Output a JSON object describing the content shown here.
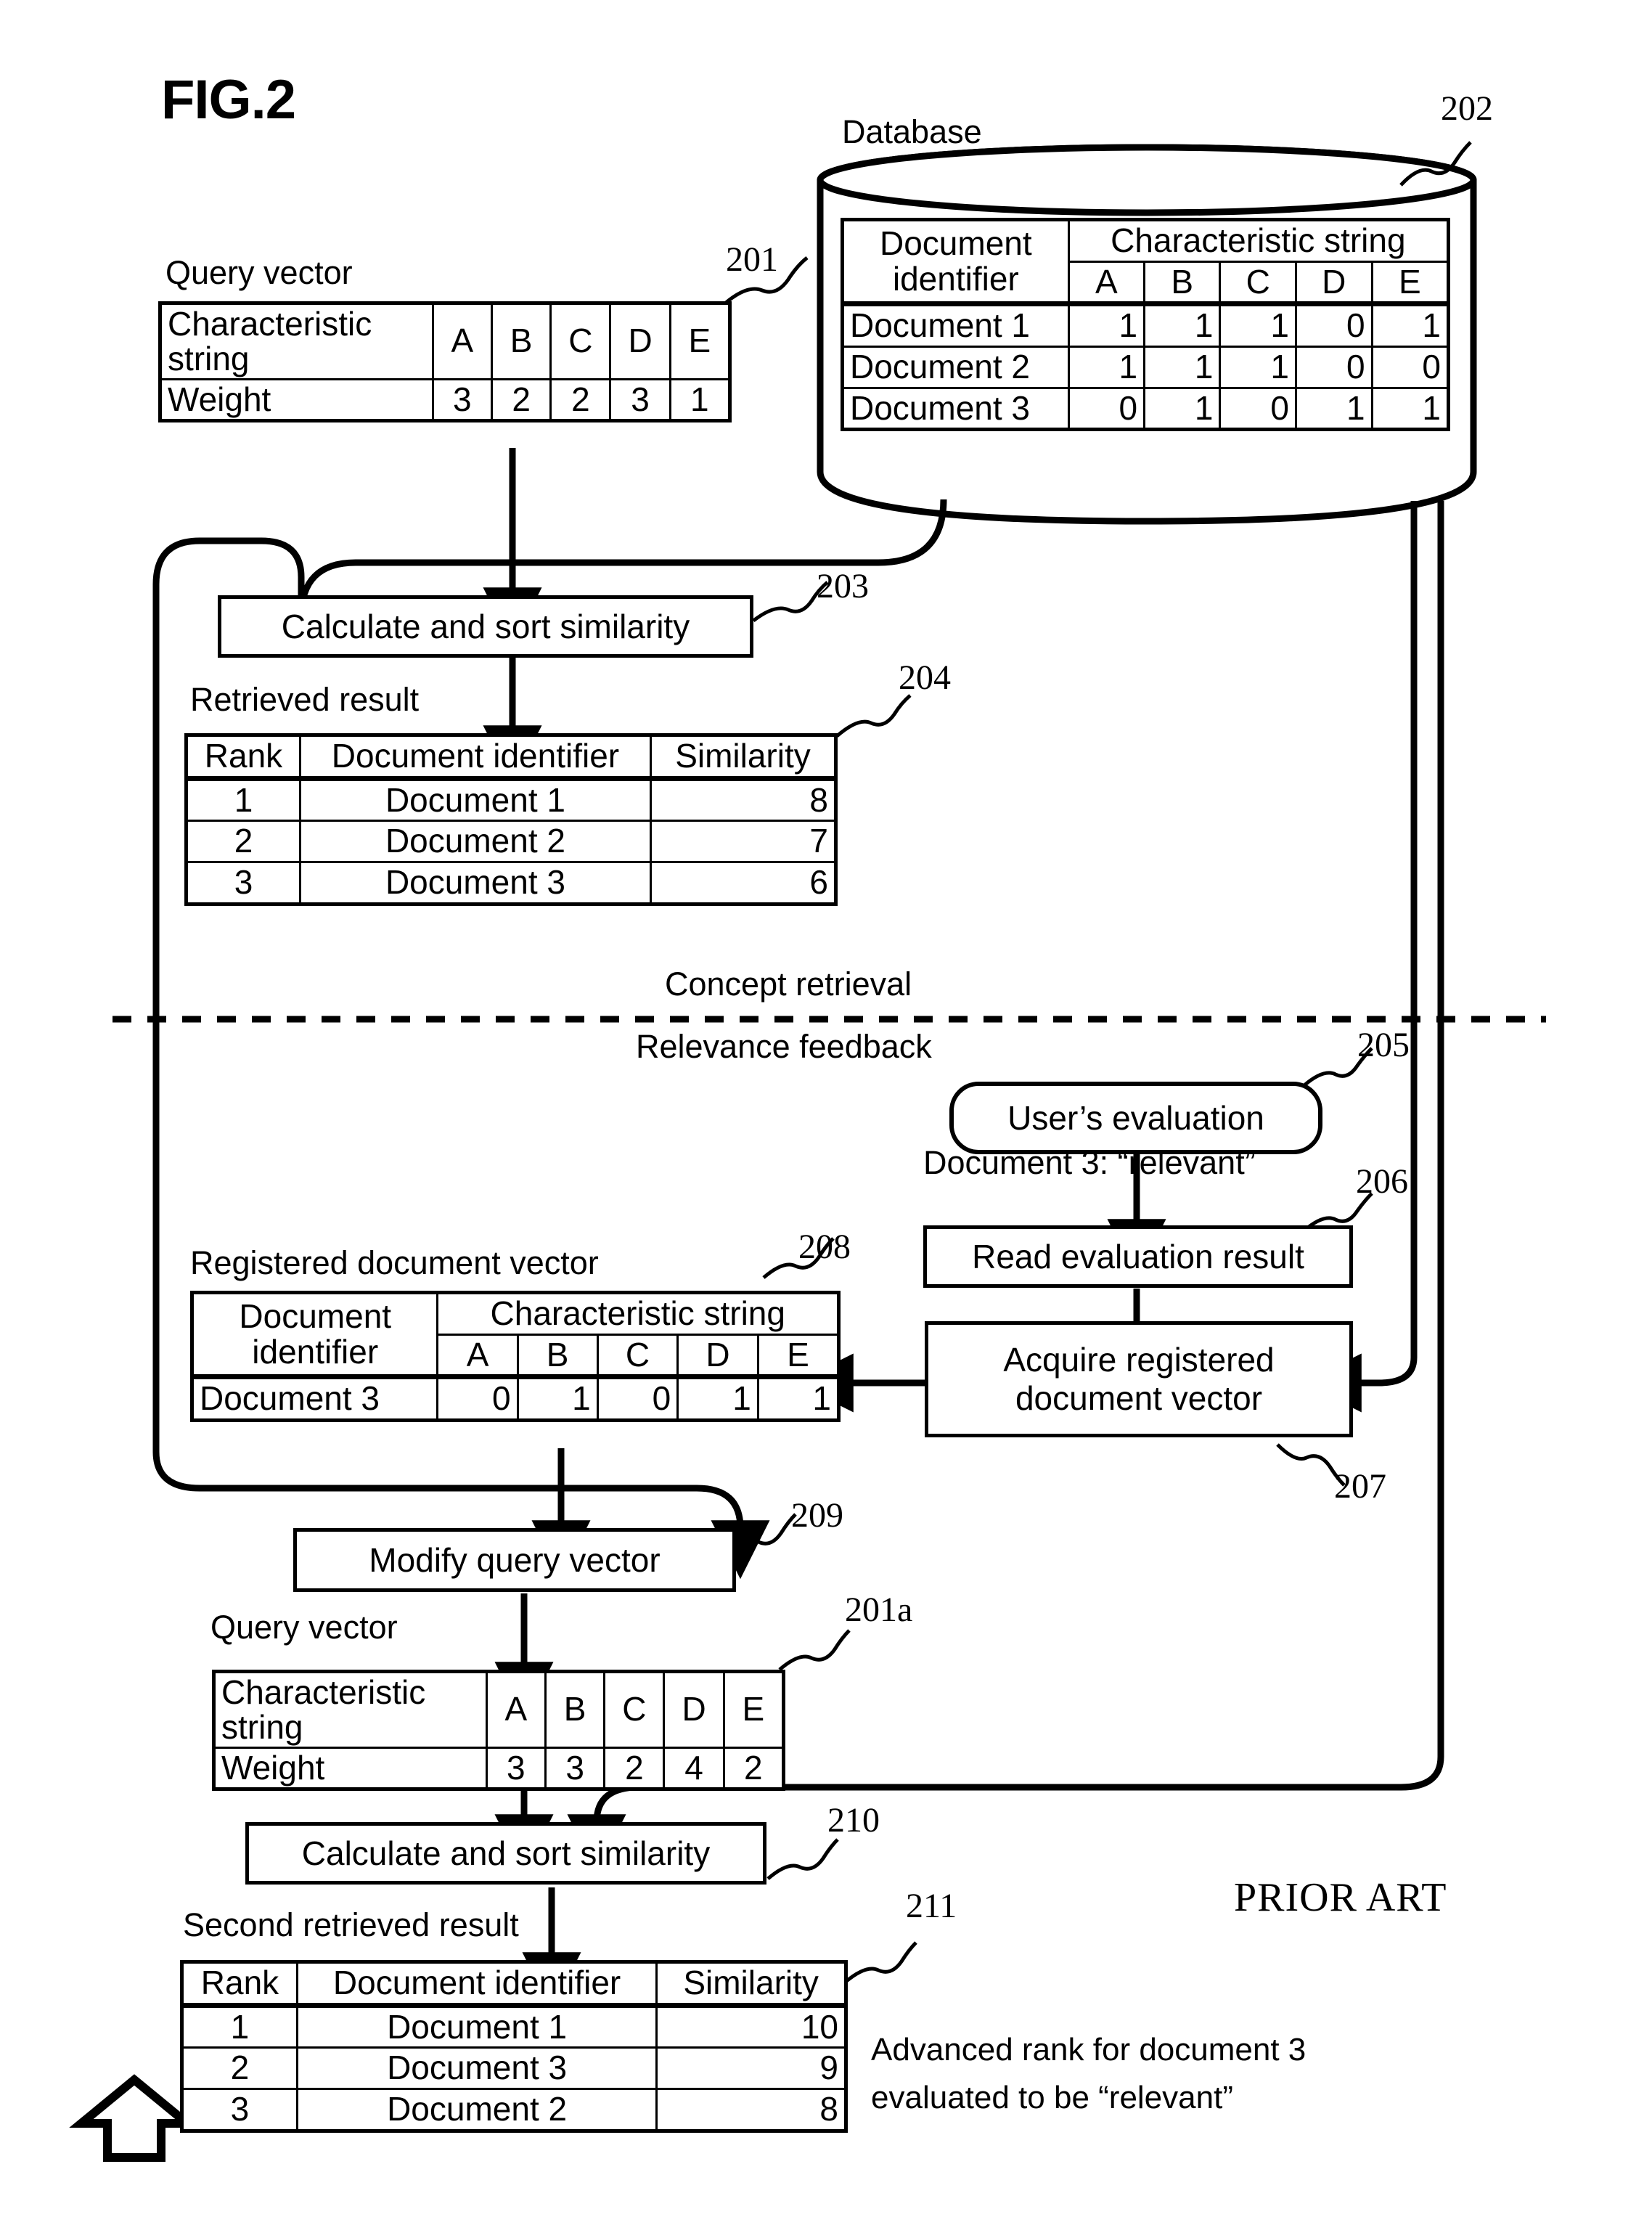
{
  "figure": {
    "title": "FIG.2",
    "prior_art": "PRIOR ART"
  },
  "labels": {
    "query_vector": "Query vector",
    "database": "Database",
    "retrieved_result": "Retrieved result",
    "concept_retrieval": "Concept retrieval",
    "relevance_feedback": "Relevance feedback",
    "registered_document_vector": "Registered document vector",
    "query_vector_2": "Query vector",
    "second_retrieved_result": "Second retrieved result",
    "evaluation_caption": "Document 3: “relevant”",
    "annotation_line1": "Advanced rank for document 3",
    "annotation_line2": "evaluated to be “relevant”"
  },
  "ref_numbers": {
    "n201": "201",
    "n202": "202",
    "n203": "203",
    "n204": "204",
    "n205": "205",
    "n206": "206",
    "n207": "207",
    "n208": "208",
    "n209": "209",
    "n210": "210",
    "n211": "211",
    "n201a": "201a"
  },
  "process_boxes": {
    "calc_sort_1": "Calculate and sort similarity",
    "users_evaluation": "User’s evaluation",
    "read_evaluation_result": "Read evaluation result",
    "acquire_registered_document_vector": "Acquire registered\ndocument vector",
    "modify_query_vector": "Modify query vector",
    "calc_sort_2": "Calculate and sort similarity"
  },
  "query_vector_201": {
    "row_header_1": "Characteristic string",
    "row_header_2": "Weight",
    "keys": [
      "A",
      "B",
      "C",
      "D",
      "E"
    ],
    "weights": [
      "3",
      "2",
      "2",
      "3",
      "1"
    ]
  },
  "query_vector_201a": {
    "row_header_1": "Characteristic string",
    "row_header_2": "Weight",
    "keys": [
      "A",
      "B",
      "C",
      "D",
      "E"
    ],
    "weights": [
      "3",
      "3",
      "2",
      "4",
      "2"
    ]
  },
  "database_202": {
    "col_header_id": "Document identifier",
    "col_header_group": "Characteristic string",
    "keys": [
      "A",
      "B",
      "C",
      "D",
      "E"
    ],
    "rows": [
      {
        "id": "Document 1",
        "values": [
          "1",
          "1",
          "1",
          "0",
          "1"
        ]
      },
      {
        "id": "Document 2",
        "values": [
          "1",
          "1",
          "1",
          "0",
          "0"
        ]
      },
      {
        "id": "Document 3",
        "values": [
          "0",
          "1",
          "0",
          "1",
          "1"
        ]
      }
    ]
  },
  "registered_document_vector_208": {
    "col_header_id": "Document identifier",
    "col_header_group": "Characteristic string",
    "keys": [
      "A",
      "B",
      "C",
      "D",
      "E"
    ],
    "rows": [
      {
        "id": "Document 3",
        "values": [
          "0",
          "1",
          "0",
          "1",
          "1"
        ]
      }
    ]
  },
  "retrieved_result_204": {
    "columns": [
      "Rank",
      "Document identifier",
      "Similarity"
    ],
    "rows": [
      {
        "rank": "1",
        "doc": "Document 1",
        "sim": "8"
      },
      {
        "rank": "2",
        "doc": "Document 2",
        "sim": "7"
      },
      {
        "rank": "3",
        "doc": "Document 3",
        "sim": "6"
      }
    ]
  },
  "second_retrieved_result_211": {
    "columns": [
      "Rank",
      "Document identifier",
      "Similarity"
    ],
    "rows": [
      {
        "rank": "1",
        "doc": "Document 1",
        "sim": "10"
      },
      {
        "rank": "2",
        "doc": "Document 3",
        "sim": "9"
      },
      {
        "rank": "3",
        "doc": "Document 2",
        "sim": "8"
      }
    ]
  },
  "colors": {
    "ink": "#000000",
    "paper": "#ffffff"
  }
}
